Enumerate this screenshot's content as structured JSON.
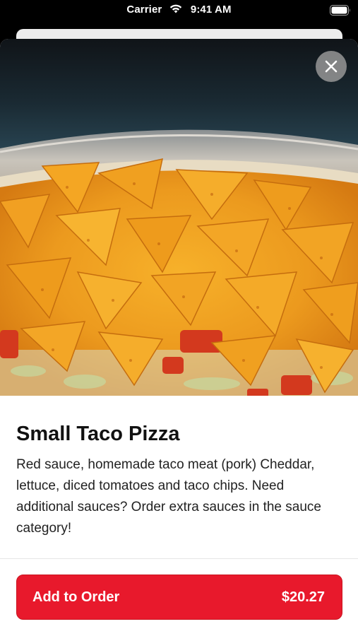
{
  "status_bar": {
    "carrier": "Carrier",
    "time": "9:41 AM",
    "icons": [
      "wifi-icon",
      "battery-icon"
    ]
  },
  "item": {
    "image_icon": "food-photo",
    "title": "Small Taco Pizza",
    "description": "Red sauce, homemade taco meat (pork) Cheddar, lettuce, diced tomatoes and taco chips. Need additional sauces? Order extra sauces in the sauce category!"
  },
  "close_icon": "close-icon",
  "footer": {
    "add_label": "Add to Order",
    "price": "$20.27"
  },
  "colors": {
    "accent": "#e8192c",
    "close_bg": "#969696"
  }
}
